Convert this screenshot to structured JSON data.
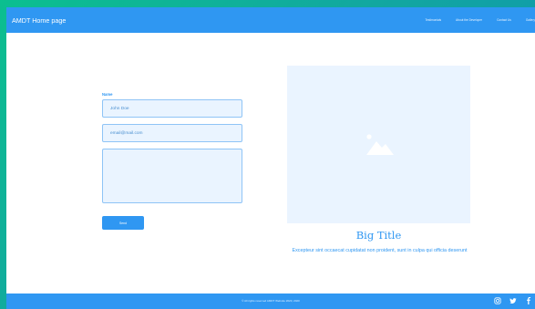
{
  "header": {
    "brand": "AMDT Home page",
    "nav": [
      "Testimonials",
      "About the Developer",
      "Contact Us",
      "Gallery"
    ]
  },
  "form": {
    "name_label": "Name",
    "name_value": "John Doe",
    "email_value": "email@mail.com",
    "message_value": "",
    "send_label": "Send"
  },
  "feature": {
    "image_icon": "image-placeholder-icon",
    "title": "Big Title",
    "text": "Excepteur sint occaecat cupidatat non proident, sunt in culpa qui officia deserunt"
  },
  "footer": {
    "copyright": "© All rights reserved AMDT Website 2020, 2020",
    "social_icons": [
      "instagram-icon",
      "twitter-icon",
      "facebook-icon"
    ]
  },
  "colors": {
    "primary": "#2f97f2",
    "field_bg": "#eaf4ff",
    "page_bg": "#ffffff"
  }
}
